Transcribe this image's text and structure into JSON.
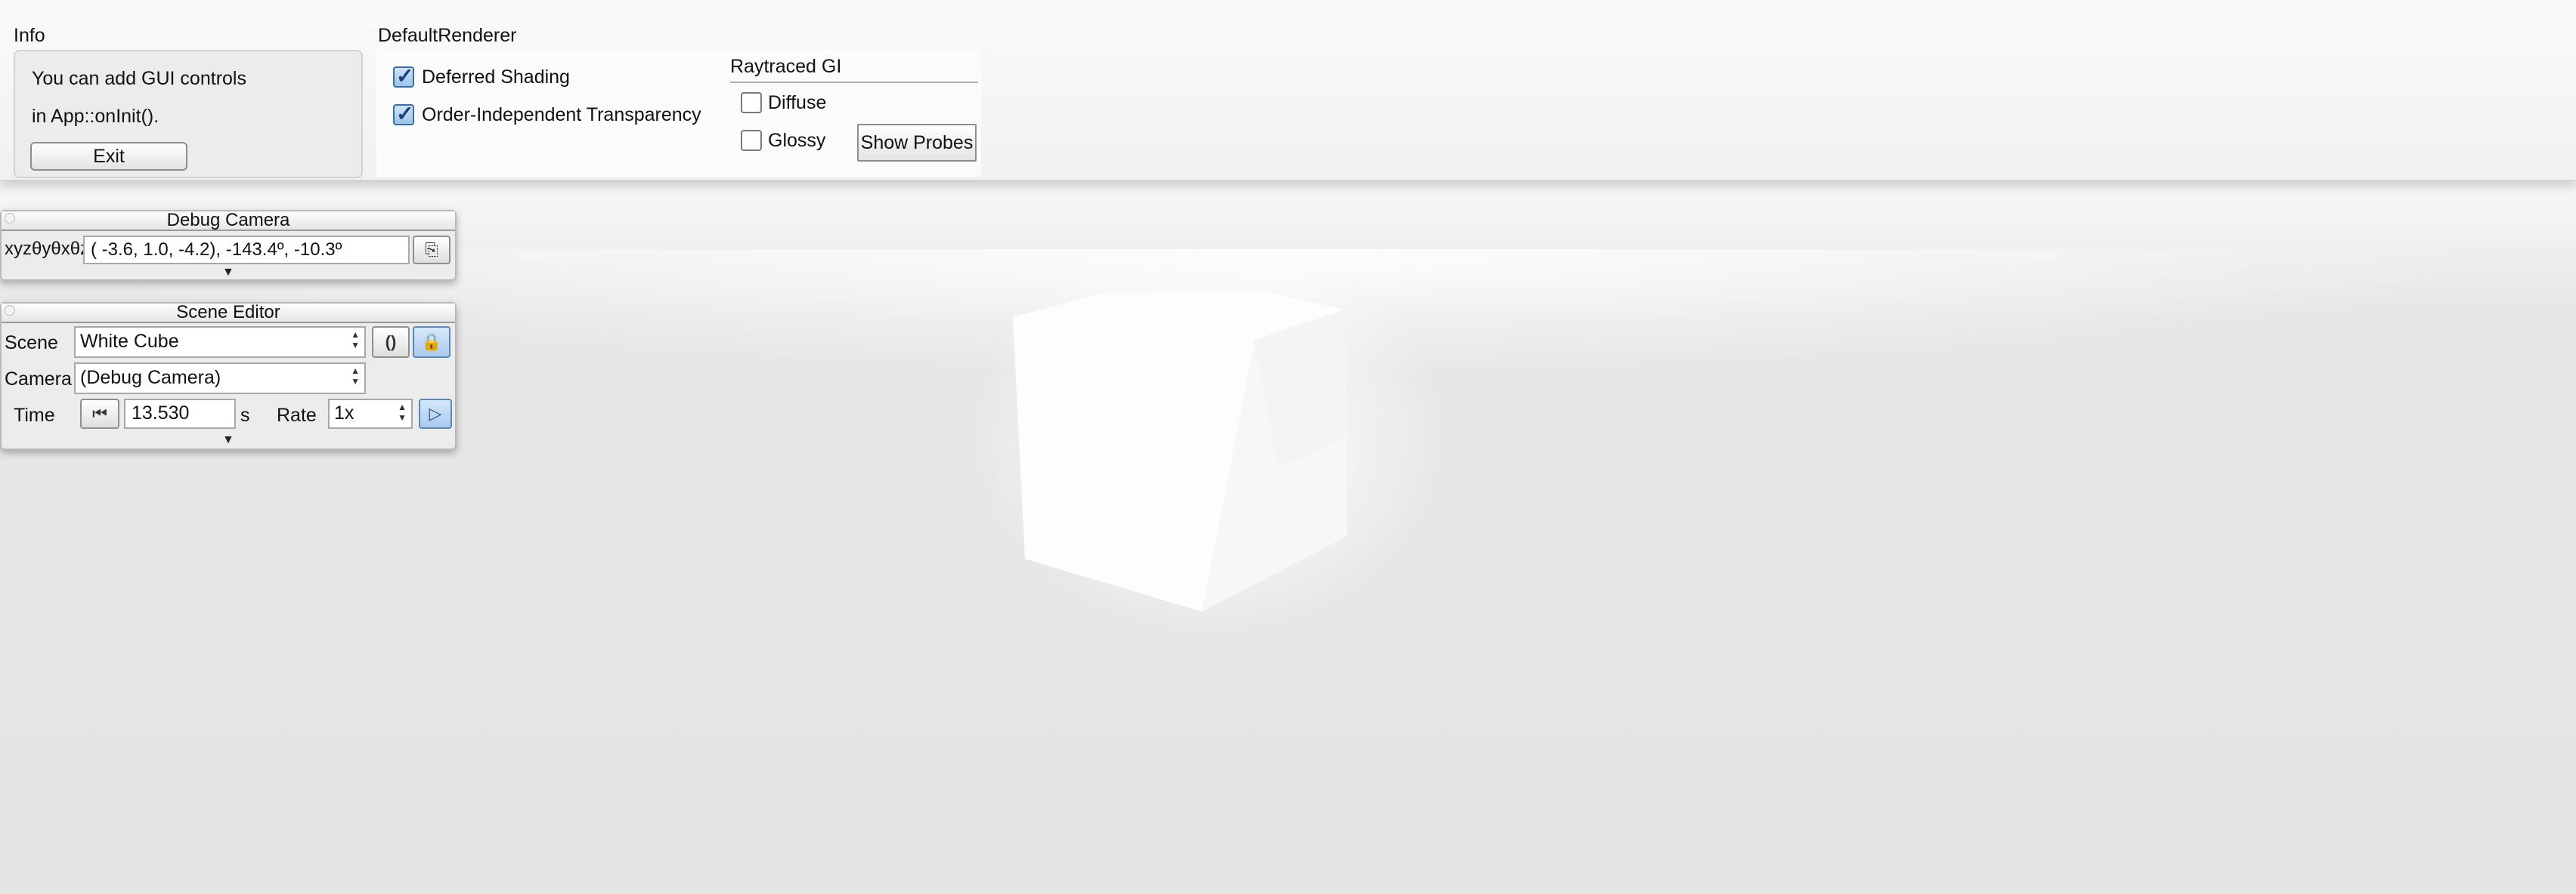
{
  "info": {
    "title": "Info",
    "line1": "You can add GUI controls",
    "line2": "in App::onInit().",
    "exit_label": "Exit"
  },
  "renderer": {
    "title": "DefaultRenderer",
    "deferred_shading": {
      "label": "Deferred Shading",
      "checked": true
    },
    "oit": {
      "label": "Order-Independent Transparency",
      "checked": true
    },
    "gi": {
      "title": "Raytraced GI",
      "diffuse": {
        "label": "Diffuse",
        "checked": false
      },
      "glossy": {
        "label": "Glossy",
        "checked": false
      },
      "show_probes_label": "Show Probes"
    }
  },
  "debug_camera": {
    "title": "Debug Camera",
    "coord_label": "xyzθyθxθz",
    "coord_value": "( -3.6,   1.0,  -4.2), -143.4º, -10.3º",
    "copy_icon": "clipboard-icon"
  },
  "scene_editor": {
    "title": "Scene Editor",
    "scene_label": "Scene",
    "scene_value": "White Cube",
    "camera_label": "Camera",
    "camera_value": "(Debug Camera)",
    "time_label": "Time",
    "time_value": "13.530",
    "time_unit": "s",
    "rate_label": "Rate",
    "rate_value": "1x",
    "reload_icon": "reload-icon",
    "lock_icon": "lock-icon",
    "rewind_icon": "rewind-icon",
    "play_icon": "play-icon"
  },
  "colors": {
    "checkbox_on": "#9cc3ea",
    "active_button": "#a9cbee"
  }
}
